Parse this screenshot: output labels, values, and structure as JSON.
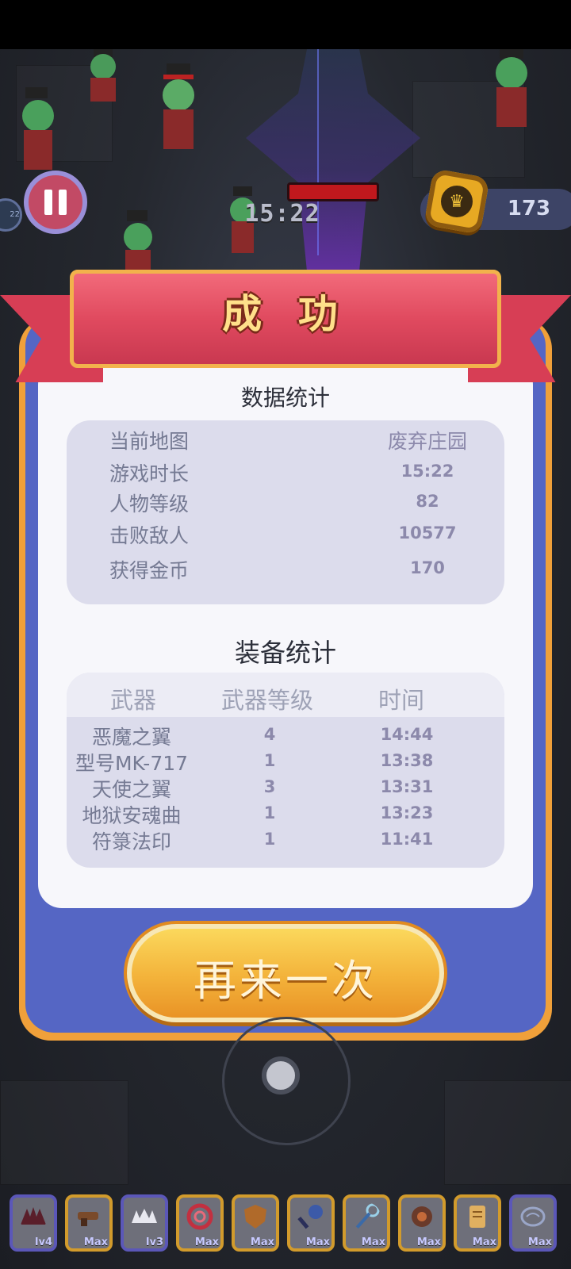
{
  "hud": {
    "timer": "15:22",
    "coins": "173",
    "left_chip": "22"
  },
  "result": {
    "title": "成 功",
    "data_section_title": "数据统计",
    "data_rows": [
      {
        "label": "当前地图",
        "value": "废弃庄园"
      },
      {
        "label": "游戏时长",
        "value": "15:22"
      },
      {
        "label": "人物等级",
        "value": "82"
      },
      {
        "label": "击败敌人",
        "value": "10577"
      },
      {
        "label": "获得金币",
        "value": "170"
      }
    ],
    "equip_section_title": "装备统计",
    "equip_headers": {
      "weapon": "武器",
      "level": "武器等级",
      "time": "时间"
    },
    "equip_rows": [
      {
        "weapon": "恶魔之翼",
        "level": "4",
        "time": "14:44"
      },
      {
        "weapon": "型号MK-717",
        "level": "1",
        "time": "13:38"
      },
      {
        "weapon": "天使之翼",
        "level": "3",
        "time": "13:31"
      },
      {
        "weapon": "地狱安魂曲",
        "level": "1",
        "time": "13:23"
      },
      {
        "weapon": "符箓法印",
        "level": "1",
        "time": "11:41"
      }
    ],
    "retry_label": "再来一次"
  },
  "skills": [
    {
      "icon": "demon-wing-icon",
      "tag": "lv4",
      "frame": "purple"
    },
    {
      "icon": "gun-icon",
      "tag": "Max",
      "frame": "gold"
    },
    {
      "icon": "angel-wing-icon",
      "tag": "lv3",
      "frame": "purple"
    },
    {
      "icon": "ring-icon",
      "tag": "Max",
      "frame": "gold"
    },
    {
      "icon": "shield-icon",
      "tag": "Max",
      "frame": "gold"
    },
    {
      "icon": "mace-icon",
      "tag": "Max",
      "frame": "gold"
    },
    {
      "icon": "staff-icon",
      "tag": "Max",
      "frame": "gold"
    },
    {
      "icon": "orb-icon",
      "tag": "Max",
      "frame": "gold"
    },
    {
      "icon": "scroll-icon",
      "tag": "Max",
      "frame": "gold"
    },
    {
      "icon": "brain-icon",
      "tag": "Max",
      "frame": "purple"
    }
  ],
  "colors": {
    "panel_blue": "#5566c4",
    "ribbon_red": "#e04a5f",
    "button_gold": "#f3b23a"
  }
}
